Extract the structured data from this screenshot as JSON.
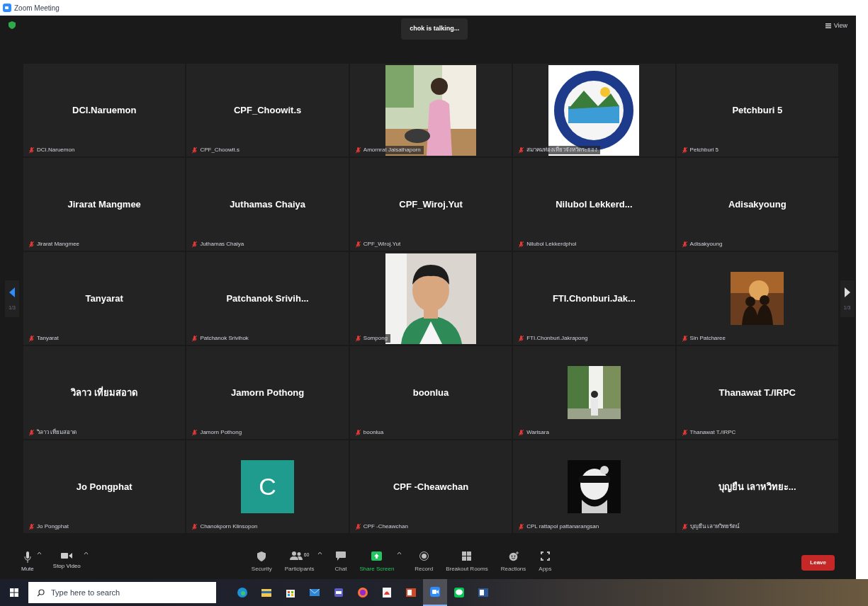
{
  "window": {
    "title": "Zoom Meeting"
  },
  "speaker_banner": "chok is talking...",
  "view_button": "View",
  "pager": {
    "left": "1/3",
    "right": "1/3"
  },
  "tiles": [
    {
      "kind": "name",
      "name": "DCI.Naruemon",
      "label": "DCI.Naruemon"
    },
    {
      "kind": "name",
      "name": "CPF_Choowit.s",
      "label": "CPF_Choowit.s"
    },
    {
      "label": "Amornrat Jaisathaporn"
    },
    {
      "label": "สมาคมท่องเที่ยวจังหวัดระยอง"
    },
    {
      "kind": "name",
      "name": "Petchburi 5",
      "label": "Petchburi 5"
    },
    {
      "kind": "name",
      "name": "Jirarat Mangmee",
      "label": "Jirarat Mangmee"
    },
    {
      "kind": "name",
      "name": "Juthamas Chaiya",
      "label": "Juthamas Chaiya"
    },
    {
      "kind": "name",
      "name": "CPF_Wiroj.Yut",
      "label": "CPF_Wiroj.Yut"
    },
    {
      "kind": "name",
      "name": "Nilubol  Lekkerd...",
      "label": "Nilubol Lekkerdphol"
    },
    {
      "kind": "name",
      "name": "Adisakyoung",
      "label": "Adisakyoung"
    },
    {
      "kind": "name",
      "name": "Tanyarat",
      "label": "Tanyarat"
    },
    {
      "kind": "name",
      "name": "Patchanok  Srivih...",
      "label": "Patchanok Srivihok"
    },
    {
      "label": "Sompong"
    },
    {
      "kind": "name",
      "name": "FTI.Chonburi.Jak...",
      "label": "FTI.Chonburi.Jakrapong"
    },
    {
      "kind": "thumb",
      "label": "Sin Patcharee"
    },
    {
      "kind": "name",
      "name": "วิลาว เที่ยมสอาด",
      "label": "วิลาว เที่ยมสอาด"
    },
    {
      "kind": "name",
      "name": "Jamorn Pothong",
      "label": "Jamorn Pothong"
    },
    {
      "kind": "name",
      "name": "boonlua",
      "label": "boonlua"
    },
    {
      "kind": "thumb",
      "label": "Warisara"
    },
    {
      "kind": "name",
      "name": "Thanawat T./IRPC",
      "label": "Thanawat T./IRPC"
    },
    {
      "kind": "name",
      "name": "Jo Pongphat",
      "label": "Jo Pongphat"
    },
    {
      "kind": "avatar",
      "letter": "C",
      "label": "Chanokporn Klinsopon"
    },
    {
      "kind": "name",
      "name": "CPF -Cheawchan",
      "label": "CPF -Cheawchan"
    },
    {
      "kind": "thumb",
      "label": "CPL rattapol pattanarangsan"
    },
    {
      "kind": "name",
      "name": "บุญยืน เลาหวิทยะ...",
      "label": "บุญยืน เลาหวิทยรัตน์"
    }
  ],
  "toolbar_left": [
    {
      "label": "Mute"
    },
    {
      "label": "Stop Video"
    }
  ],
  "toolbar": [
    {
      "label": "Security",
      "color": "#bdbdbd"
    },
    {
      "label": "Participants",
      "count": "60",
      "color": "#bdbdbd"
    },
    {
      "label": "Chat",
      "color": "#bdbdbd"
    },
    {
      "label": "Share Screen",
      "color": "#22c55e"
    },
    {
      "label": "Record",
      "color": "#bdbdbd"
    },
    {
      "label": "Breakout Rooms",
      "color": "#bdbdbd"
    },
    {
      "label": "Reactions",
      "color": "#bdbdbd"
    },
    {
      "label": "Apps",
      "color": "#bdbdbd"
    }
  ],
  "leave_button": "Leave",
  "taskbar": {
    "search": {
      "placeholder": "Type here to search"
    },
    "apps": [
      {
        "active": false
      },
      {
        "active": false
      },
      {
        "active": false
      },
      {
        "active": false
      },
      {
        "active": false
      },
      {
        "active": false
      },
      {
        "active": false
      },
      {
        "active": false
      },
      {
        "active": true
      },
      {
        "active": false
      },
      {
        "active": false
      }
    ]
  }
}
